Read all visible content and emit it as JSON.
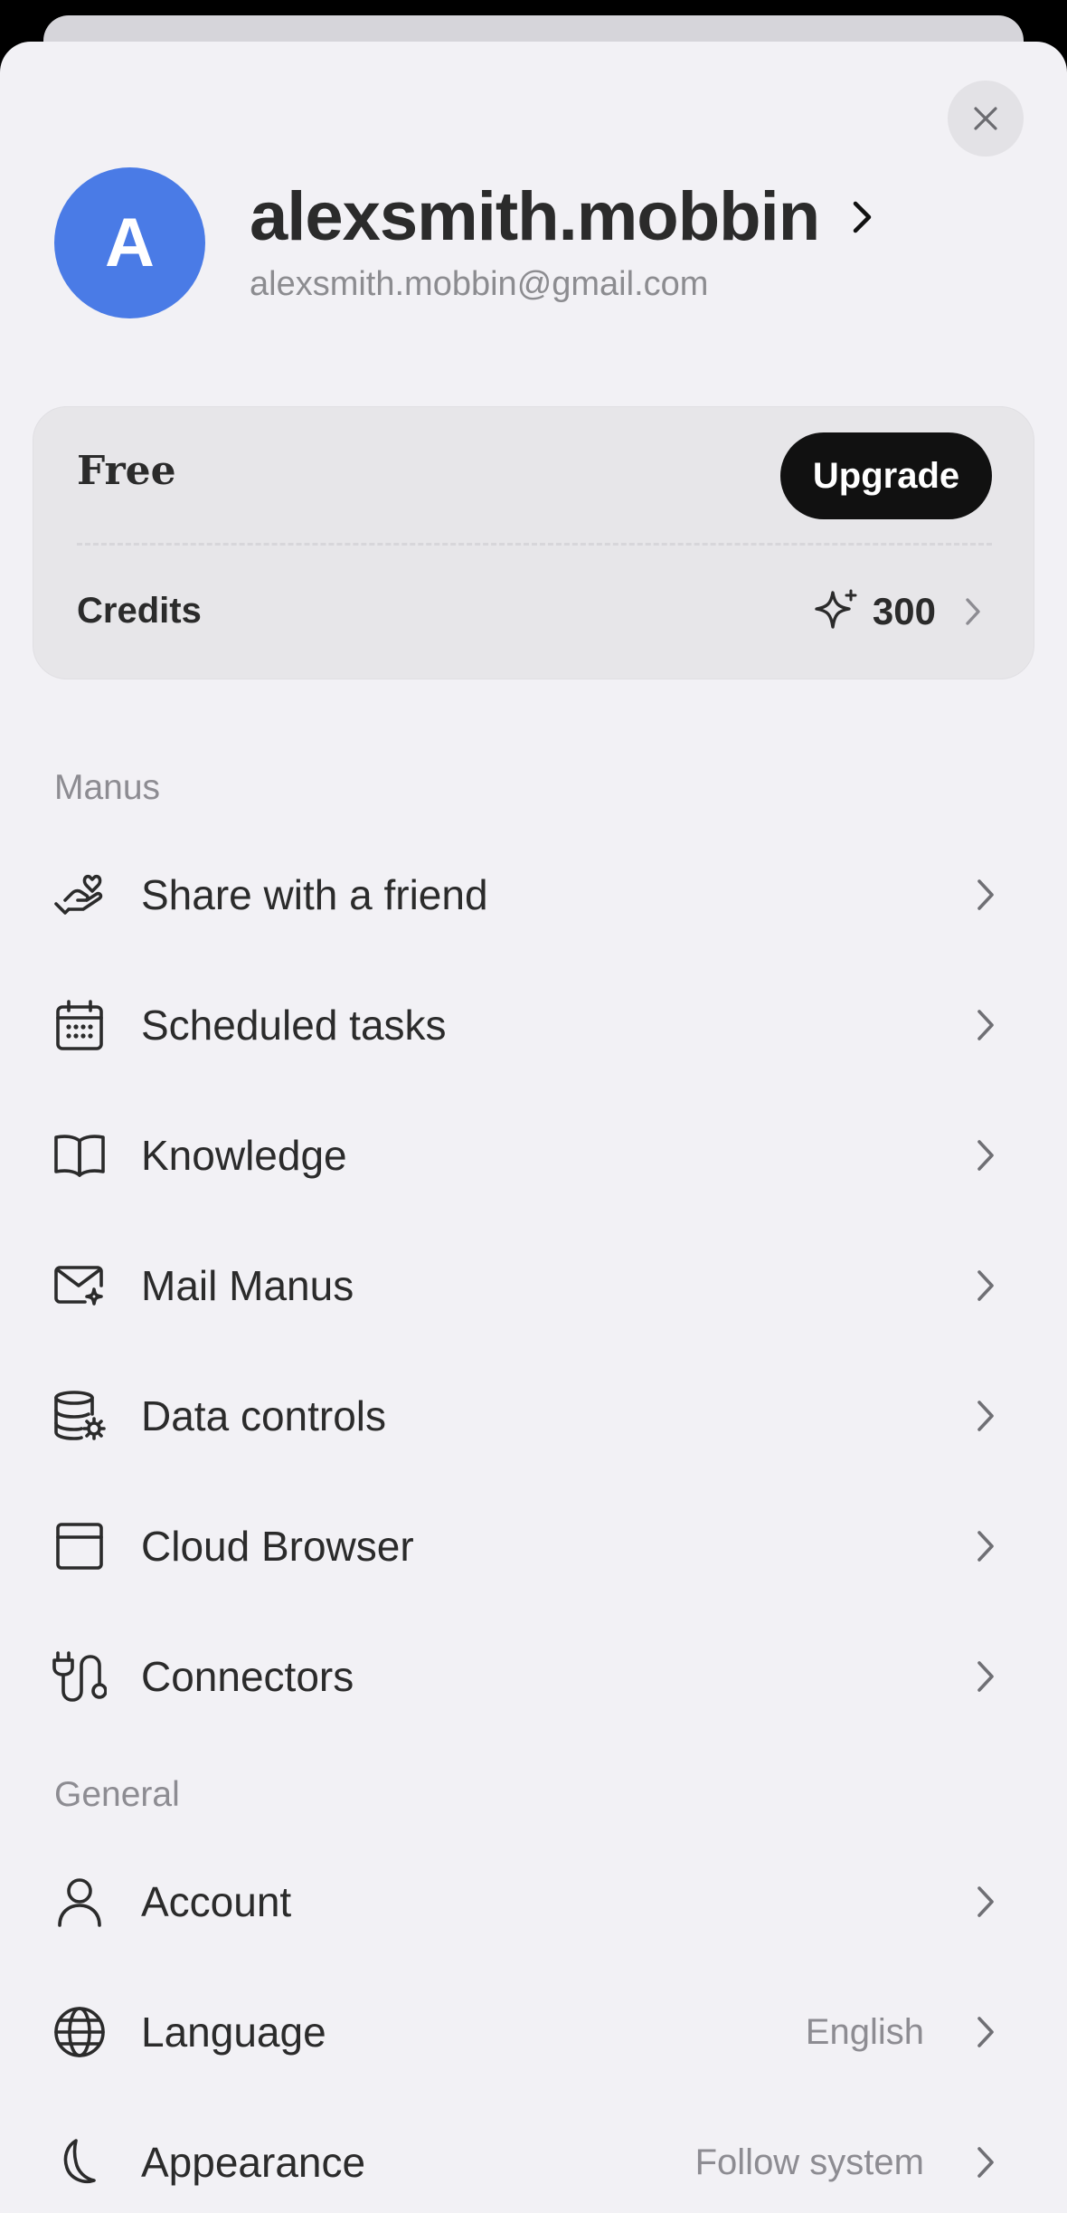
{
  "profile": {
    "avatar_initial": "A",
    "username": "alexsmith.mobbin",
    "email": "alexsmith.mobbin@gmail.com"
  },
  "plan": {
    "name": "Free",
    "upgrade_label": "Upgrade",
    "credits_label": "Credits",
    "credits_value": "300"
  },
  "sections": {
    "manus_title": "Manus",
    "general_title": "General"
  },
  "menu": {
    "share": "Share with a friend",
    "scheduled": "Scheduled tasks",
    "knowledge": "Knowledge",
    "mail": "Mail Manus",
    "data": "Data controls",
    "browser": "Cloud Browser",
    "connectors": "Connectors",
    "account": "Account",
    "language": "Language",
    "language_value": "English",
    "appearance": "Appearance",
    "appearance_value": "Follow system"
  },
  "colors": {
    "avatar": "#4a7be6",
    "upgrade_button": "#111111",
    "sheet_background": "#f2f1f5"
  }
}
